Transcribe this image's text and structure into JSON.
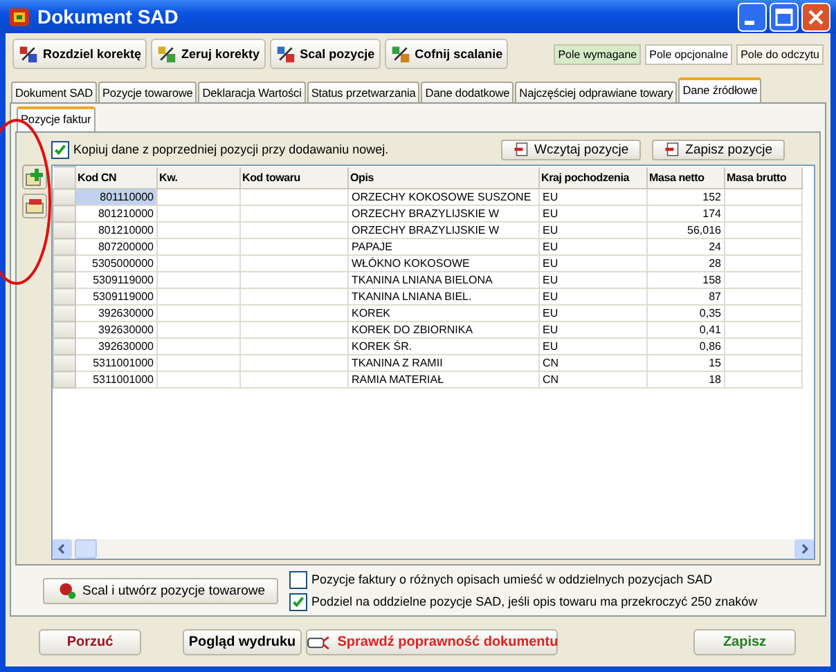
{
  "window": {
    "title": "Dokument SAD"
  },
  "toolbar": [
    {
      "label": "Rozdziel korektę"
    },
    {
      "label": "Zeruj korekty"
    },
    {
      "label": "Scal pozycje"
    },
    {
      "label": "Cofnij scalanie"
    }
  ],
  "legend": [
    {
      "label": "Pole wymagane",
      "color": "#d6ecc9"
    },
    {
      "label": "Pole opcjonalne",
      "color": "#ffffff"
    },
    {
      "label": "Pole do odczytu",
      "color": "#f7f5ec"
    }
  ],
  "tabs": [
    {
      "label": "Dokument SAD",
      "selected": false
    },
    {
      "label": "Pozycje towarowe",
      "selected": false
    },
    {
      "label": "Deklaracja Wartości",
      "selected": false
    },
    {
      "label": "Status przetwarzania",
      "selected": false
    },
    {
      "label": "Dane dodatkowe",
      "selected": false
    },
    {
      "label": "Najczęściej odprawiane towary",
      "selected": false
    },
    {
      "label": "Dane źródłowe",
      "selected": true
    }
  ],
  "subtabs": [
    {
      "label": "Pozycje faktur",
      "selected": true
    }
  ],
  "copy_option": {
    "label": "Kopiuj dane z poprzedniej pozycji przy dodawaniu nowej.",
    "checked": true
  },
  "panel_buttons": [
    {
      "label": "Wczytaj pozycje"
    },
    {
      "label": "Zapisz pozycje"
    }
  ],
  "table": {
    "columns": [
      "Kod CN",
      "Kw.",
      "Kod towaru",
      "Opis",
      "Kraj pochodzenia",
      "Masa netto",
      "Masa brutto"
    ],
    "rows": [
      {
        "selected": true,
        "cells": [
          "801110000",
          "",
          "",
          "ORZECHY KOKOSOWE SUSZONE",
          "EU",
          "152",
          ""
        ]
      },
      {
        "selected": false,
        "cells": [
          "801210000",
          "",
          "",
          "ORZECHY BRAZYLIJSKIE W",
          "EU",
          "174",
          ""
        ]
      },
      {
        "selected": false,
        "cells": [
          "801210000",
          "",
          "",
          "ORZECHY BRAZYLIJSKIE W",
          "EU",
          "56,016",
          ""
        ]
      },
      {
        "selected": false,
        "cells": [
          "807200000",
          "",
          "",
          "PAPAJE",
          "EU",
          "24",
          ""
        ]
      },
      {
        "selected": false,
        "cells": [
          "5305000000",
          "",
          "",
          "WŁÓKNO KOKOSOWE",
          "EU",
          "28",
          ""
        ]
      },
      {
        "selected": false,
        "cells": [
          "5309119000",
          "",
          "",
          "TKANINA LNIANA BIELONA",
          "EU",
          "158",
          ""
        ]
      },
      {
        "selected": false,
        "cells": [
          "5309119000",
          "",
          "",
          "TKANINA LNIANA BIEL.",
          "EU",
          "87",
          ""
        ]
      },
      {
        "selected": false,
        "cells": [
          "392630000",
          "",
          "",
          "KOREK",
          "EU",
          "0,35",
          ""
        ]
      },
      {
        "selected": false,
        "cells": [
          "392630000",
          "",
          "",
          "KOREK DO ZBIORNIKA",
          "EU",
          "0,41",
          ""
        ]
      },
      {
        "selected": false,
        "cells": [
          "392630000",
          "",
          "",
          "KOREK ŚR.",
          "EU",
          "0,86",
          ""
        ]
      },
      {
        "selected": false,
        "cells": [
          "5311001000",
          "",
          "",
          "TKANINA Z RAMII",
          "CN",
          "15",
          ""
        ]
      },
      {
        "selected": false,
        "cells": [
          "5311001000",
          "",
          "",
          "RAMIA MATERIAŁ",
          "CN",
          "18",
          ""
        ]
      }
    ]
  },
  "merge_button": {
    "label": "Scal i utwórz pozycje towarowe"
  },
  "options": [
    {
      "label": "Pozycje faktury o różnych opisach umieść w oddzielnych pozycjach SAD",
      "checked": false
    },
    {
      "label": "Podziel na oddzielne pozycje SAD, jeśli opis towaru ma przekroczyć 250 znaków",
      "checked": true
    }
  ],
  "footer_buttons": [
    {
      "label": "Porzuć",
      "color": "#a01020",
      "icon": false
    },
    {
      "label": "Pogląd wydruku",
      "color": "#000000",
      "icon": false
    },
    {
      "label": "Sprawdź poprawność dokumentu",
      "color": "#e02020",
      "icon": true
    },
    {
      "label": "Zapisz",
      "color": "#208020",
      "icon": false
    }
  ]
}
